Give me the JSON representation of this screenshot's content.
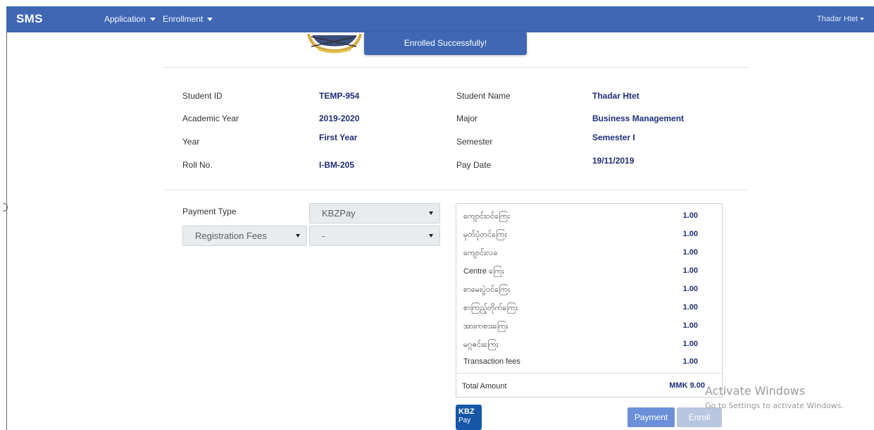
{
  "navbar": {
    "brand": "SMS",
    "menu": [
      {
        "label": "Application"
      },
      {
        "label": "Enrollment"
      }
    ],
    "user": "Thadar Htet"
  },
  "toast": {
    "message": "Enrolled Successfully!"
  },
  "student_info": {
    "student_id_label": "Student ID",
    "student_id": "TEMP-954",
    "student_name_label": "Student Name",
    "student_name": "Thadar Htet",
    "academic_year_label": "Academic Year",
    "academic_year": "2019-2020",
    "major_label": "Major",
    "major": "Business Management",
    "year_label": "Year",
    "year": "First Year",
    "semester_label": "Semester",
    "semester": "Semester I",
    "roll_no_label": "Roll No.",
    "roll_no": "I-BM-205",
    "pay_date_label": "Pay Date",
    "pay_date": "19/11/2019"
  },
  "payment": {
    "payment_type_label": "Payment Type",
    "payment_type_value": "KBZPay",
    "fee_category_value": "Registration Fees",
    "fee_sub_value": "-"
  },
  "fees": {
    "items": [
      {
        "name": "ကျောင်းဝင်ကြေး",
        "amount": "1.00"
      },
      {
        "name": "မှတ်ပုံတင်ကြေး",
        "amount": "1.00"
      },
      {
        "name": "ကျောင်းလခ",
        "amount": "1.00"
      },
      {
        "name": "Centre ကြေး",
        "amount": "1.00"
      },
      {
        "name": "စာမေးပွဲဝင်ကြေး",
        "amount": "1.00"
      },
      {
        "name": "စာကြည့်တိုက်ကြေး",
        "amount": "1.00"
      },
      {
        "name": "အားကစားကြေး",
        "amount": "1.00"
      },
      {
        "name": "မဂ္ဂဇင်းကြေး",
        "amount": "1.00"
      },
      {
        "name": "Transaction fees",
        "amount": "1.00"
      }
    ],
    "total_label": "Total Amount",
    "total_value": "MMK 9.00"
  },
  "kbz_logo": {
    "line1": "KBZ",
    "line2": "Pay"
  },
  "buttons": {
    "payment": "Payment",
    "enroll": "Enroll"
  },
  "watermark": {
    "line1": "Activate Windows",
    "line2": "Go to Settings to activate Windows."
  }
}
